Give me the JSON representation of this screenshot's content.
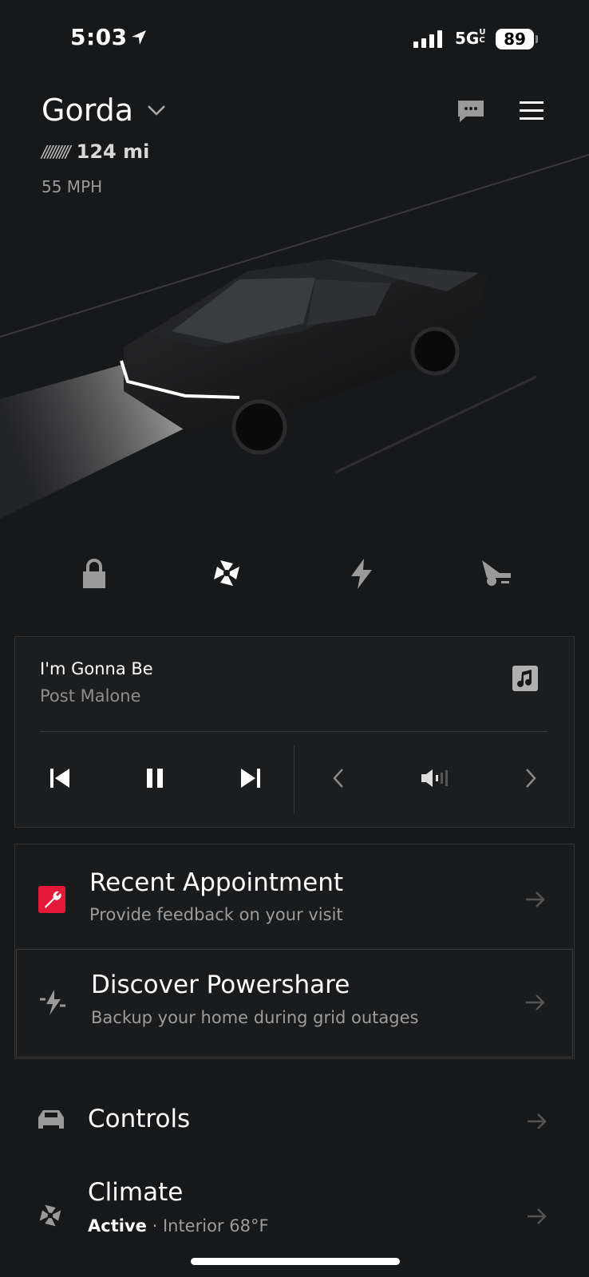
{
  "status_bar": {
    "time": "5:03",
    "network": "5G",
    "network_suffix": "UC",
    "battery": "89"
  },
  "header": {
    "vehicle_name": "Gorda",
    "range_bars": "/////////",
    "range": "124 mi",
    "speed": "55 MPH"
  },
  "quick_actions": [
    "lock-icon",
    "fan-icon",
    "charge-icon",
    "summon-icon"
  ],
  "media": {
    "song": "I'm Gonna Be",
    "artist": "Post Malone"
  },
  "cards": [
    {
      "title": "Recent Appointment",
      "subtitle": "Provide feedback on your visit"
    },
    {
      "title": "Discover Powershare",
      "subtitle": "Backup your home during grid outages"
    }
  ],
  "list": {
    "controls": {
      "title": "Controls"
    },
    "climate": {
      "title": "Climate",
      "status": "Active",
      "sep": "·",
      "detail": "Interior 68°F"
    }
  },
  "colors": {
    "background": "#17181a",
    "accent_red": "#e31937",
    "muted_text": "#9c9c9c"
  }
}
